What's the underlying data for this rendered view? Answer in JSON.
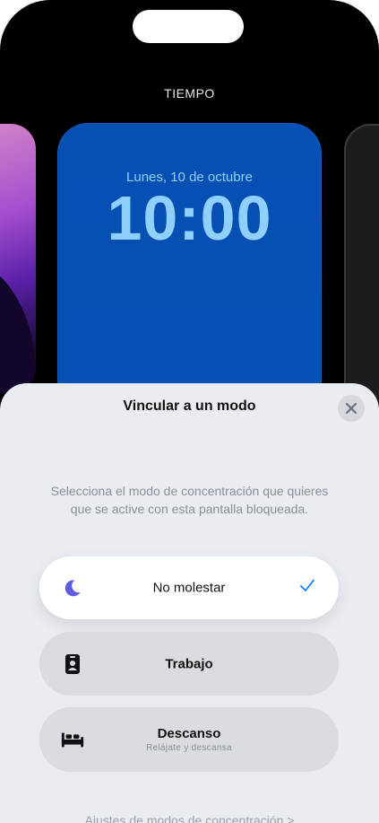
{
  "header": {
    "label": "TIEMPO"
  },
  "lockscreen": {
    "date": "Lunes, 10 de octubre",
    "time": "10:00"
  },
  "sheet": {
    "title": "Vincular a un modo",
    "description": "Selecciona el modo de concentración que quieres que se active con esta pantalla bloqueada.",
    "options": [
      {
        "label": "No molestar",
        "icon": "moon-icon",
        "selected": true
      },
      {
        "label": "Trabajo",
        "icon": "id-badge-icon",
        "selected": false
      },
      {
        "label": "Descanso",
        "sublabel": "Relájate y descansa",
        "icon": "bed-icon",
        "selected": false
      }
    ],
    "footer_link": "Ajustes de modos de concentración >"
  },
  "colors": {
    "accent": "#0a84ff",
    "moon": "#5e5ce6",
    "lock_text": "#8fd0ff",
    "card_bg": "#0550b5"
  }
}
